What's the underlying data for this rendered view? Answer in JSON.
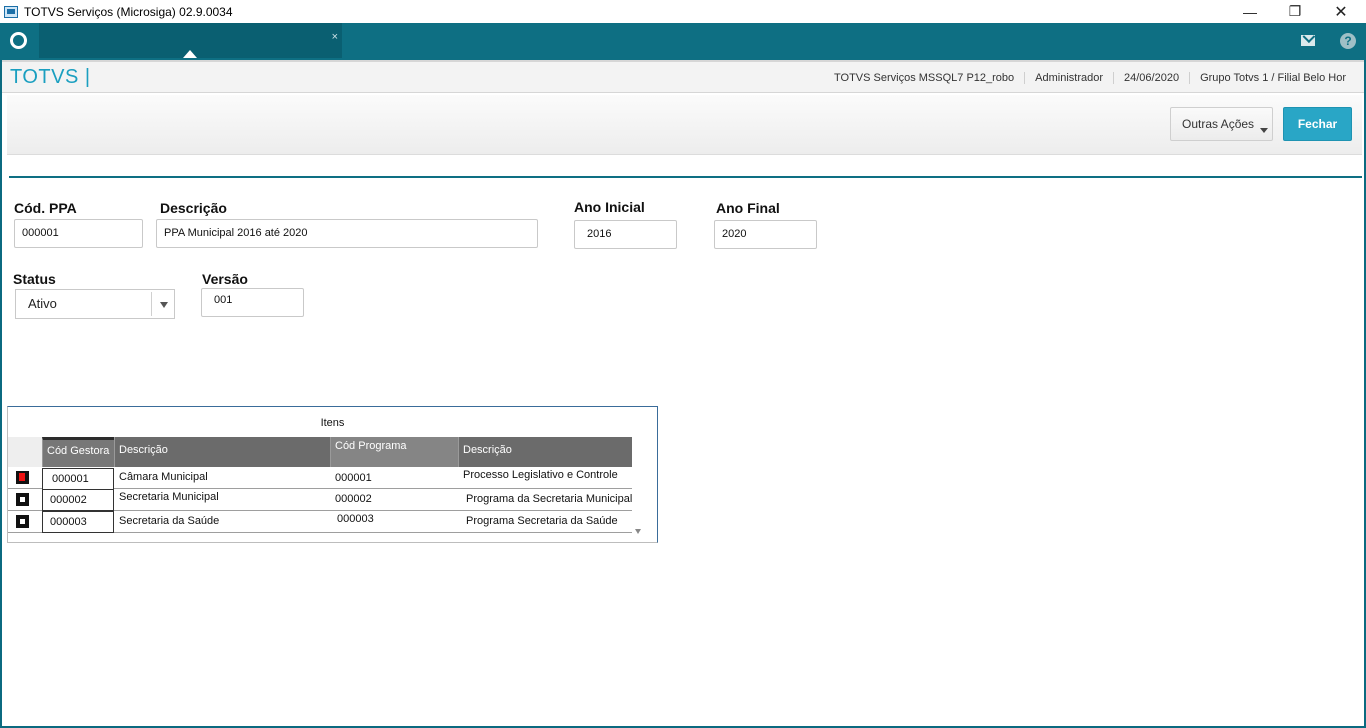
{
  "window": {
    "title": "TOTVS Serviços (Microsiga) 02.9.0034",
    "minimize_glyph": "—",
    "maximize_glyph": "❐",
    "close_glyph": "✕"
  },
  "tabbar": {
    "tab_close_glyph": "×",
    "help_glyph": "?"
  },
  "infobar": {
    "brand": "TOTVS |",
    "environment": "TOTVS Serviços MSSQL7 P12_robo",
    "user": "Administrador",
    "date": "24/06/2020",
    "branch": "Grupo Totvs 1 / Filial Belo Hor"
  },
  "actions": {
    "outras_acoes": "Outras Ações",
    "fechar": "Fechar"
  },
  "form": {
    "cod_ppa_label": "Cód. PPA",
    "cod_ppa_value": "000001",
    "descricao_label": "Descrição",
    "descricao_value": "PPA Municipal 2016 até 2020",
    "ano_inicial_label": "Ano Inicial",
    "ano_inicial_value": "2016",
    "ano_final_label": "Ano Final",
    "ano_final_value": "2020",
    "status_label": "Status",
    "status_value": "Ativo",
    "versao_label": "Versão",
    "versao_value": "001"
  },
  "grid": {
    "title": "Itens",
    "headers": [
      "Cód Gestora",
      "Descrição",
      "Cód Programa",
      "Descrição"
    ],
    "rows": [
      {
        "cod_gestora": "000001",
        "descricao": "Câmara Municipal",
        "cod_programa": "000001",
        "programa": "Processo Legislativo e Controle",
        "status_color": "#e11111"
      },
      {
        "cod_gestora": "000002",
        "descricao": "Secretaria Municipal",
        "cod_programa": "000002",
        "programa": "Programa da Secretaria Municipal",
        "status_color": "#ffffff"
      },
      {
        "cod_gestora": "000003",
        "descricao": "Secretaria da Saúde",
        "cod_programa": "000003",
        "programa": "Programa Secretaria da Saúde",
        "status_color": "#ffffff"
      }
    ]
  },
  "colors": {
    "accent_teal": "#0e6f83",
    "button_blue": "#29a6c6",
    "brand_blue": "#1a9fc0"
  }
}
